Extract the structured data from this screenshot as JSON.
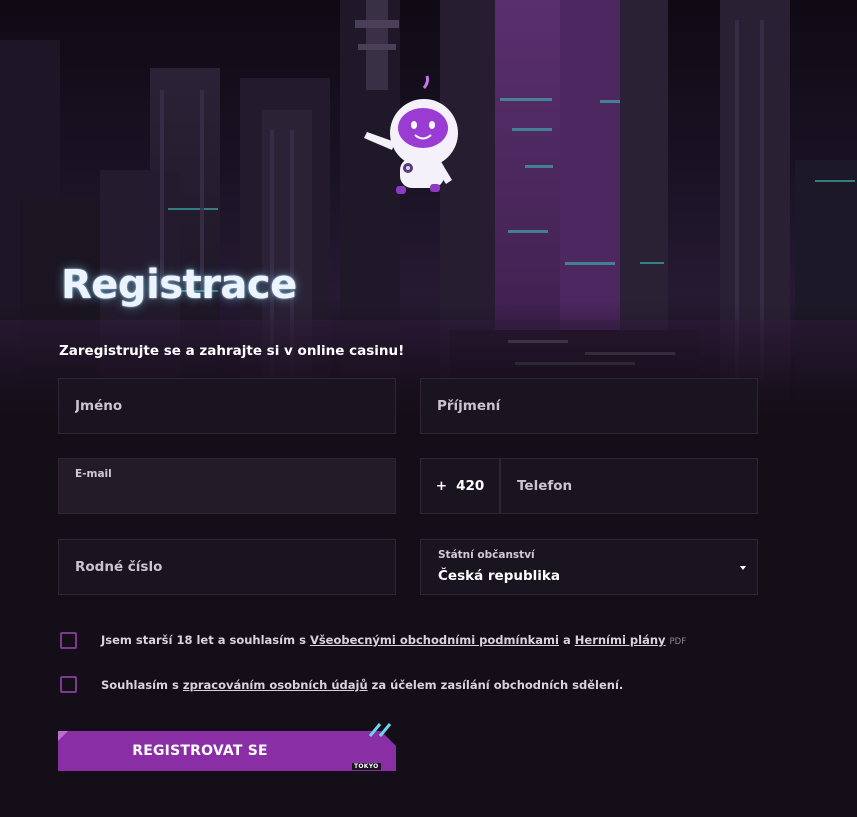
{
  "header": {
    "title": "Registrace",
    "subtitle": "Zaregistrujte se a zahrajte si v online casinu!"
  },
  "form": {
    "first_name": {
      "placeholder": "Jméno",
      "value": ""
    },
    "last_name": {
      "placeholder": "Příjmení",
      "value": ""
    },
    "email": {
      "label": "E-mail",
      "value": ""
    },
    "phone_prefix": {
      "plus": "+",
      "code": "420"
    },
    "phone": {
      "placeholder": "Telefon",
      "value": ""
    },
    "birth_number": {
      "placeholder": "Rodné číslo",
      "value": ""
    },
    "citizenship": {
      "label": "Státní občanství",
      "value": "Česká republika"
    }
  },
  "consents": {
    "age": {
      "text_before": "Jsem starší 18 let a souhlasím s ",
      "link1": "Všeobecnými obchodními podmínkami",
      "text_between": " a ",
      "link2": "Herními plány",
      "pdf": "PDF",
      "checked": false
    },
    "marketing": {
      "text_before": "Souhlasím s ",
      "link": "zpracováním osobních údajů",
      "text_after": " za účelem zasílání obchodních sdělení.",
      "checked": false
    }
  },
  "submit": {
    "label": "REGISTROVAT SE",
    "logo_text": "TOKYO"
  },
  "colors": {
    "background": "#140e18",
    "field_bg": "#1a1420",
    "field_border": "#2e2536",
    "accent": "#8a2ea6",
    "checkbox_border": "#7b3a8e",
    "stripes": "#6fd3ef"
  },
  "icons": {
    "mascot": "astronaut-mascot-icon",
    "caret": "caret-down-icon"
  }
}
